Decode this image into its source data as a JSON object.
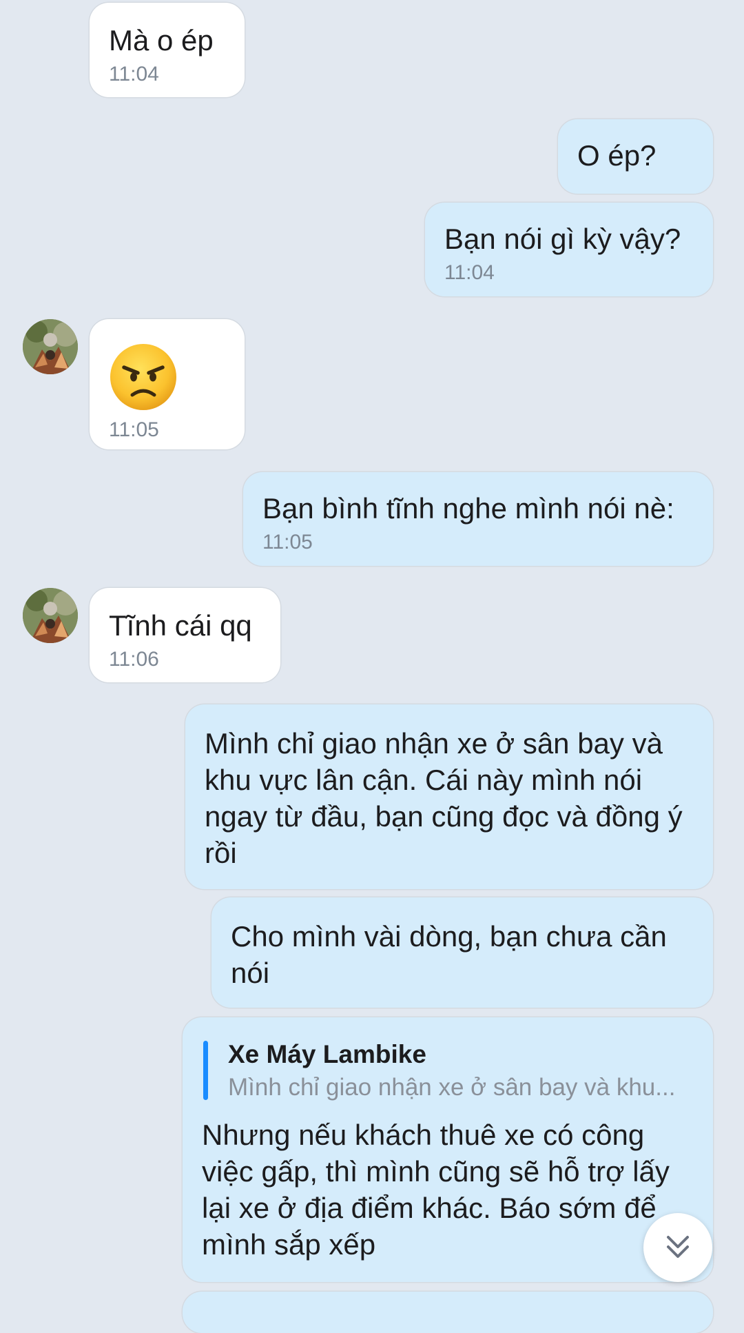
{
  "messages": [
    {
      "text": "Mà o ép",
      "time": "11:04"
    },
    {
      "text": "O ép?"
    },
    {
      "text": "Bạn nói gì kỳ vậy?",
      "time": "11:04"
    },
    {
      "emoji": "angry-face",
      "time": "11:05"
    },
    {
      "text": "Bạn bình tĩnh nghe mình nói nè:",
      "time": "11:05"
    },
    {
      "text": "Tĩnh cái qq",
      "time": "11:06"
    },
    {
      "text": "Mình chỉ giao nhận xe ở sân bay và khu vực lân cận. Cái này mình nói ngay từ đầu, bạn cũng đọc và đồng ý rồi"
    },
    {
      "text": "Cho mình vài dòng, bạn chưa cần nói"
    },
    {
      "reply_to": {
        "name": "Xe Máy Lambike",
        "preview": "Mình chỉ giao nhận xe ở sân bay và khu..."
      },
      "text": "Nhưng nếu khách thuê xe có công việc gấp, thì mình cũng sẽ hỗ trợ lấy lại xe ở địa điểm khác. Báo sớm để mình sắp xếp"
    }
  ],
  "icons": {
    "avatar": "contact-avatar",
    "scroll_down": "double-chevron-down-icon"
  },
  "colors": {
    "background": "#e2e8f0",
    "incoming_bubble": "#ffffff",
    "outgoing_bubble": "#d5ecfb",
    "quote_accent": "#1a8cff",
    "timestamp": "#7d8793"
  }
}
